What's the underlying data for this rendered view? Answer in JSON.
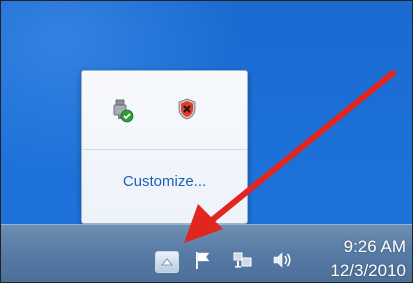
{
  "popup": {
    "customize_label": "Customize...",
    "icons": [
      "usb-safe-remove-icon",
      "security-alert-icon"
    ]
  },
  "taskbar": {
    "show_hidden_icons_glyph": "▲",
    "icons": [
      "action-center-flag-icon",
      "network-icon",
      "volume-icon"
    ],
    "time": "9:26 AM",
    "date": "12/3/2010"
  },
  "colors": {
    "desktop": "#1c6fd6",
    "taskbar": "#587ca5",
    "link": "#1e5fb4",
    "annotation_arrow": "#e0261f"
  }
}
